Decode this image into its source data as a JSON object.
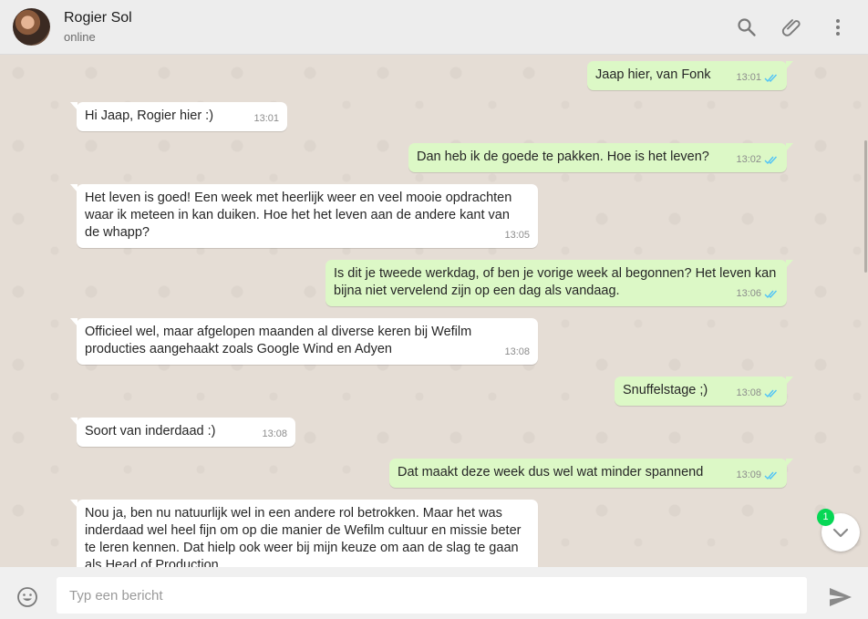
{
  "header": {
    "contact_name": "Rogier Sol",
    "contact_status": "online",
    "icons": [
      "search-icon",
      "attach-icon",
      "menu-icon"
    ]
  },
  "colors": {
    "incoming": "#ffffff",
    "outgoing": "#dcf8c6",
    "ticks": "#4fc3f7",
    "badge": "#06d755"
  },
  "messages": [
    {
      "direction": "out",
      "text": "Jaap hier, van Fonk",
      "time": "13:01",
      "read": true
    },
    {
      "direction": "in",
      "text": "Hi Jaap, Rogier hier :)",
      "time": "13:01"
    },
    {
      "direction": "out",
      "text": "Dan heb ik de goede te pakken. Hoe is het leven?",
      "time": "13:02",
      "read": true
    },
    {
      "direction": "in",
      "text": "Het leven is goed! Een week met heerlijk weer en veel mooie opdrachten waar ik meteen in kan duiken. Hoe het het leven aan de andere kant van de whapp?",
      "time": "13:05"
    },
    {
      "direction": "out",
      "text": "Is dit je tweede werkdag, of ben je vorige week al begonnen? Het leven kan bijna niet vervelend zijn op een dag als vandaag.",
      "time": "13:06",
      "read": true
    },
    {
      "direction": "in",
      "text": "Officieel wel, maar afgelopen maanden al diverse keren bij Wefilm producties aangehaakt zoals Google Wind en Adyen",
      "time": "13:08"
    },
    {
      "direction": "out",
      "text": "Snuffelstage ;)",
      "time": "13:08",
      "read": true
    },
    {
      "direction": "in",
      "text": "Soort van inderdaad :)",
      "time": "13:08"
    },
    {
      "direction": "out",
      "text": "Dat maakt deze week dus wel wat minder spannend",
      "time": "13:09",
      "read": true
    },
    {
      "direction": "in",
      "text": "Nou ja, ben nu natuurlijk wel in een andere rol betrokken. Maar het was inderdaad wel heel fijn om op die manier de Wefilm cultuur en missie beter te leren kennen. Dat hielp ook weer bij mijn keuze om aan de slag te gaan als Head of Production"
    }
  ],
  "scroll_down": {
    "unread_count": "1",
    "icon": "chevron-down-icon"
  },
  "composer": {
    "placeholder": "Typ een bericht",
    "value": "",
    "icons": [
      "emoji-icon",
      "send-icon"
    ]
  }
}
